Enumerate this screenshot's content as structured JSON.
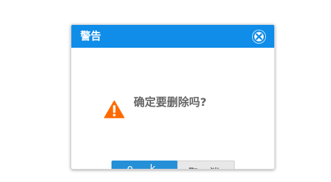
{
  "dialog": {
    "title": "警告",
    "message": "确定要删除吗?",
    "ok_label": "o k",
    "cancel_label": "取 消",
    "close_icon": "close-circle-icon",
    "warning_icon": "warning-triangle-icon"
  },
  "colors": {
    "titlebar": "#0f8de8",
    "ok_button": "#2590d8",
    "warning": "#ff6a00"
  }
}
